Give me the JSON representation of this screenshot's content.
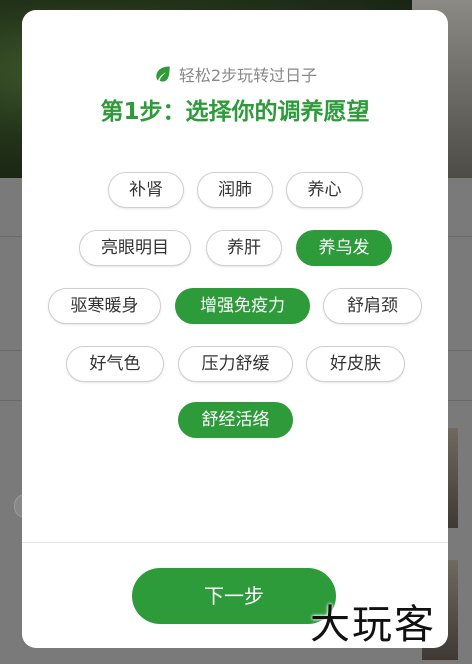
{
  "colors": {
    "accent": "#2e9b3b",
    "tag_border": "#cfcfcf",
    "subtitle": "#888888"
  },
  "modal": {
    "subtitle": "轻松2步玩转过日子",
    "subtitle_icon": "leaf-icon",
    "title": "第1步：选择你的调养愿望",
    "tags": [
      {
        "label": "补肾",
        "selected": false
      },
      {
        "label": "润肺",
        "selected": false
      },
      {
        "label": "养心",
        "selected": false
      },
      {
        "label": "亮眼明目",
        "selected": false
      },
      {
        "label": "养肝",
        "selected": false
      },
      {
        "label": "养乌发",
        "selected": true
      },
      {
        "label": "驱寒暖身",
        "selected": false
      },
      {
        "label": "增强免疫力",
        "selected": true
      },
      {
        "label": "舒肩颈",
        "selected": false
      },
      {
        "label": "好气色",
        "selected": false
      },
      {
        "label": "压力舒缓",
        "selected": false
      },
      {
        "label": "好皮肤",
        "selected": false
      },
      {
        "label": "舒经活络",
        "selected": true
      }
    ],
    "next_button": "下一步"
  },
  "watermark": "大玩客"
}
